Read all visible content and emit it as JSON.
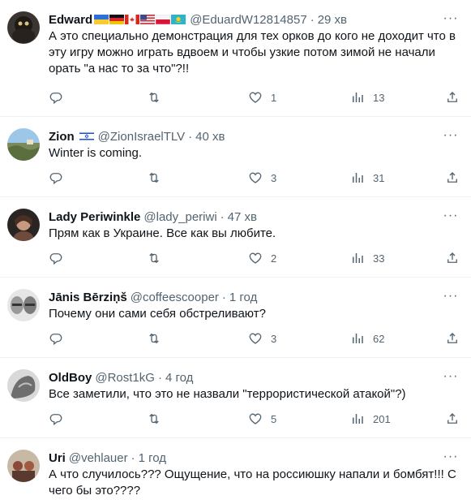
{
  "tweets": [
    {
      "name": "Edward",
      "flags": [
        "ukraine-flag",
        "germany-flag",
        "canada-flag",
        "usa-flag",
        "poland-flag",
        "kazakhstan-flag"
      ],
      "handle": "@EduardW12814857",
      "separator": "·",
      "time": "29 хв",
      "text": "А это специально демонстрация для тех орков до кого не доходит что в эту игру можно играть вдвоем и чтобы узкие потом зимой не начали орать \"а нас то за что\"?!!",
      "replies": "",
      "retweets": "",
      "likes": "1",
      "views": "13"
    },
    {
      "name": "Zion",
      "flags": [
        "israel-flag"
      ],
      "handle": "@ZionIsraelTLV",
      "separator": "·",
      "time": "40 хв",
      "text": "Winter is coming.",
      "replies": "",
      "retweets": "",
      "likes": "3",
      "views": "31"
    },
    {
      "name": "Lady Periwinkle",
      "flags": [],
      "handle": "@lady_periwi",
      "separator": "·",
      "time": "47 хв",
      "text": "Прям как в Украине. Все как вы любите.",
      "replies": "",
      "retweets": "",
      "likes": "2",
      "views": "33"
    },
    {
      "name": "Jānis Bērziņš",
      "flags": [],
      "handle": "@coffeescooper",
      "separator": "·",
      "time": "1 год",
      "text": "Почему они сами себя обстреливают?",
      "replies": "",
      "retweets": "",
      "likes": "3",
      "views": "62"
    },
    {
      "name": "OldBoy",
      "flags": [],
      "handle": "@Rost1kG",
      "separator": "·",
      "time": "4 год",
      "text": "Все заметили, что это не назвали \"террористической атакой\"?)",
      "replies": "",
      "retweets": "",
      "likes": "5",
      "views": "201"
    },
    {
      "name": "Uri",
      "flags": [],
      "handle": "@vehlauer",
      "separator": "·",
      "time": "1 год",
      "text": "А что случилось??? Ощущение, что на россиюшку напали и бомбят!!! С чего бы это????",
      "replies": "",
      "retweets": "",
      "likes": "",
      "views": ""
    }
  ],
  "more_label": "···",
  "colors": {
    "text": "#0f1419",
    "secondary": "#536471",
    "divider": "#eff3f4"
  }
}
